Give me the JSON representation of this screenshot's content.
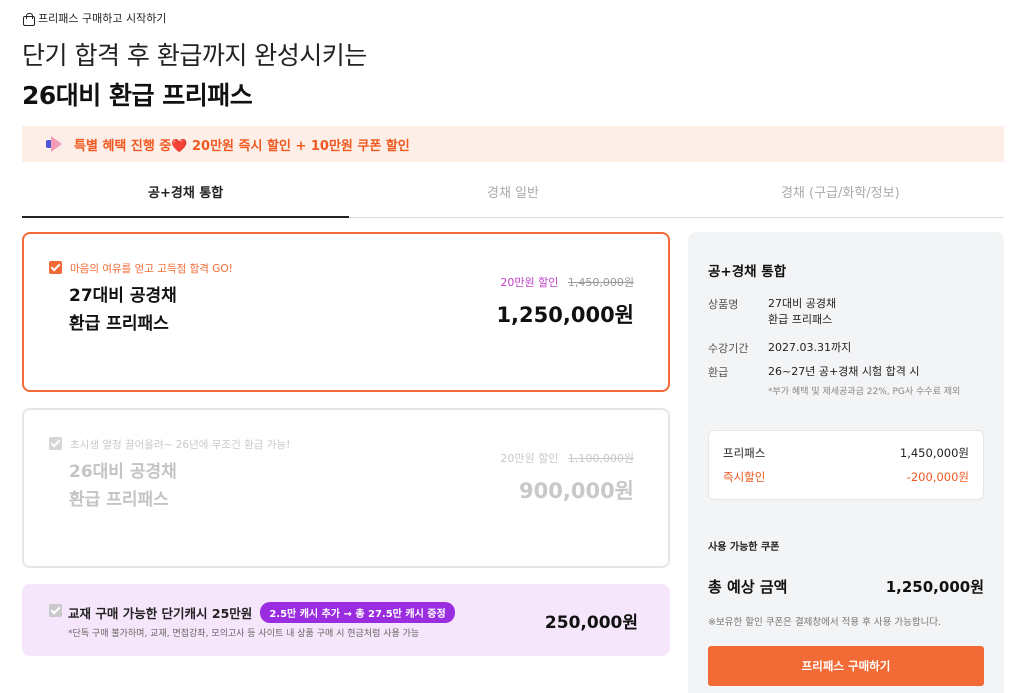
{
  "breadcrumb": "프리패스 구매하고 시작하기",
  "headline": {
    "sub": "단기 합격 후 환급까지 완성시키는",
    "main": "26대비 환급 프리패스"
  },
  "promo": "특별 혜택 진행 중❤️ 20만원 즉시 할인 + 10만원 쿠폰 할인",
  "tabs": [
    "공+경채 통합",
    "경채 일반",
    "경채 (구급/화학/정보)"
  ],
  "products": [
    {
      "tag": "마음의 여유를 얻고 고득점 합격 GO!",
      "title_line1": "27대비 공경채",
      "title_line2": "환급 프리패스",
      "discount": "20만원 할인",
      "original": "1,450,000원",
      "price": "1,250,000원"
    },
    {
      "tag": "초시생 열정 끌어올려~ 26년에 무조건 환급 가능!",
      "title_line1": "26대비 공경채",
      "title_line2": "환급 프리패스",
      "discount": "20만원 할인",
      "original": "1,100,000원",
      "price": "900,000원"
    }
  ],
  "cash": {
    "title": "교재 구매 가능한 단기캐시 25만원",
    "pill": "2.5만 캐시 추가 → 총 27.5만 캐시 증정",
    "note": "*단독 구매 불가하며, 교재, 면접강좌, 모의고사 등 사이트 내 상품 구매 시 현금처럼 사용 가능",
    "price": "250,000원"
  },
  "summary": {
    "title": "공+경채 통합",
    "product_label": "상품명",
    "product_line1": "27대비 공경채",
    "product_line2": "환급 프리패스",
    "period_label": "수강기간",
    "period_value": "2027.03.31까지",
    "refund_label": "환급",
    "refund_value": "26~27년 공+경채 시험 합격 시",
    "refund_note": "*부가 혜택 및 제세공과금 22%, PG사 수수료 제외",
    "freepass_label": "프리패스",
    "freepass_value": "1,450,000원",
    "instant_label": "즉시할인",
    "instant_value": "-200,000원",
    "coupon_label": "사용 가능한 쿠폰",
    "total_label": "총 예상 금액",
    "total_value": "1,250,000원",
    "hint": "※보유한 할인 쿠폰은 결제창에서 적용 후 사용 가능합니다.",
    "buy_label": "프리패스 구매하기"
  },
  "colors": {
    "accent": "#f26a35",
    "purple": "#9b2de0",
    "promo_bg": "#fdeee7"
  }
}
